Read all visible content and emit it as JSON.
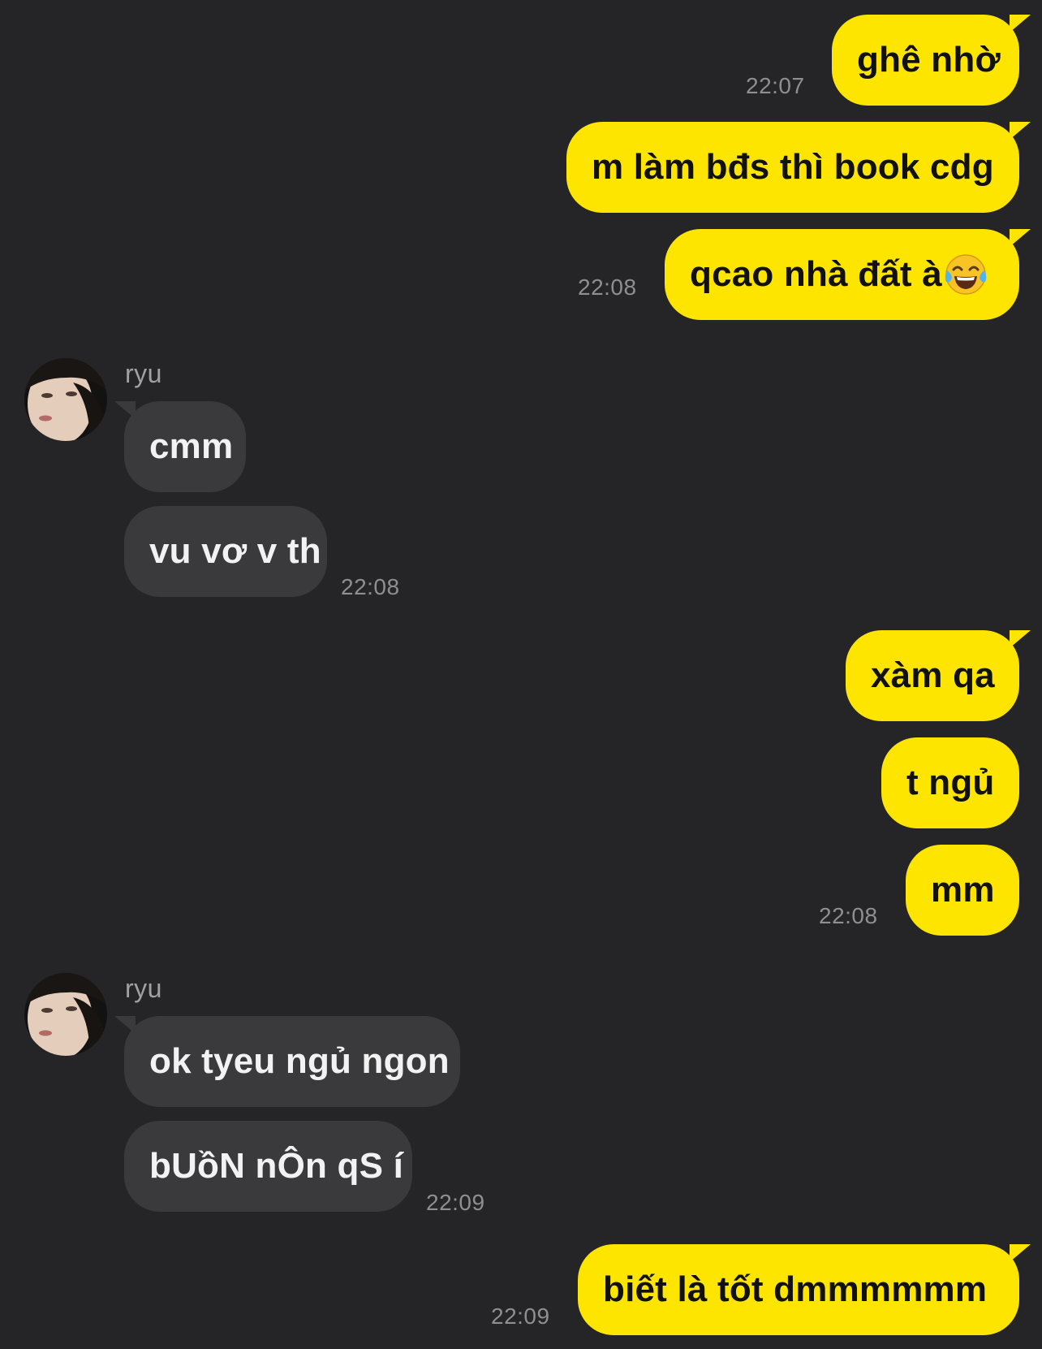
{
  "colors": {
    "background": "#252527",
    "outgoing_bubble": "#FDE500",
    "incoming_bubble": "#3A3A3C",
    "timestamp": "#8E8E93"
  },
  "messages": [
    {
      "direction": "out",
      "text": "ghê nhờ",
      "time": "22:07"
    },
    {
      "direction": "out",
      "text": "m làm bđs thì book cdg",
      "time": null
    },
    {
      "direction": "out",
      "text": "qcao nhà đất à",
      "emoji": "face-with-tears-of-joy",
      "time": "22:08"
    },
    {
      "direction": "in",
      "sender": "ryu",
      "text": "cmm",
      "time": null
    },
    {
      "direction": "in",
      "text": "vu vơ v th",
      "time": "22:08"
    },
    {
      "direction": "out",
      "text": "xàm qa",
      "time": null
    },
    {
      "direction": "out",
      "text": "t ngủ",
      "time": null
    },
    {
      "direction": "out",
      "text": "mm",
      "time": "22:08"
    },
    {
      "direction": "in",
      "sender": "ryu",
      "text": "ok tyeu ngủ ngon",
      "time": null
    },
    {
      "direction": "in",
      "text": "bUồN nÔn qS í",
      "time": "22:09"
    },
    {
      "direction": "out",
      "text": "biết là tốt dmmmmmm",
      "time": "22:09"
    }
  ]
}
